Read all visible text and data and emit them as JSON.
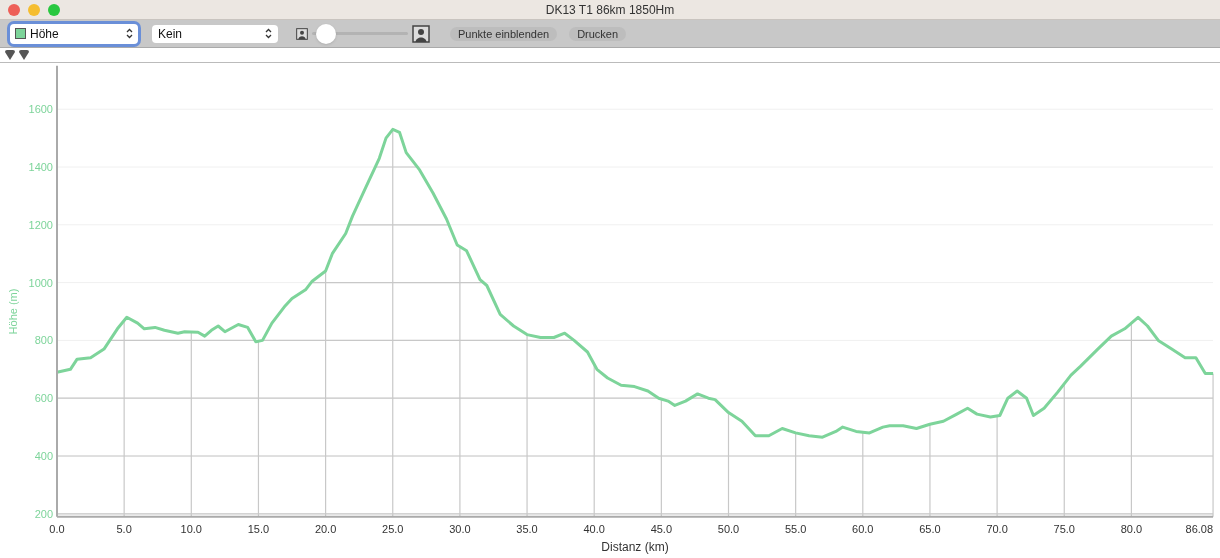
{
  "window": {
    "title": "DK13 T1 86km 1850Hm"
  },
  "toolbar": {
    "secondary_select": {
      "value": "Kein"
    },
    "zoom_slider": {
      "level": 0.05
    },
    "buttons": [
      "Punkte einblenden",
      "Drucken"
    ]
  },
  "chart": {
    "chart_data": {
      "type": "line",
      "grid": true,
      "ref_lines": [
        {
          "axis": "x",
          "value": 5
        },
        {
          "axis": "x",
          "value": 10
        },
        {
          "axis": "x",
          "value": 15
        },
        {
          "axis": "x",
          "value": 20
        },
        {
          "axis": "x",
          "value": 25
        },
        {
          "axis": "x",
          "value": 30
        },
        {
          "axis": "x",
          "value": 35
        },
        {
          "axis": "x",
          "value": 40
        },
        {
          "axis": "x",
          "value": 45
        },
        {
          "axis": "x",
          "value": 50
        },
        {
          "axis": "x",
          "value": 55
        },
        {
          "axis": "x",
          "value": 60
        },
        {
          "axis": "x",
          "value": 65
        },
        {
          "axis": "x",
          "value": 70
        },
        {
          "axis": "x",
          "value": 75
        },
        {
          "axis": "x",
          "value": 80
        },
        {
          "axis": "x",
          "value": 86.08
        }
      ],
      "xlabel": "Distanz (km)",
      "ylabel": "Höhe (m)",
      "xlim": [
        0,
        86.08
      ],
      "ylim": [
        190,
        1750
      ],
      "xticks": [
        {
          "value": 0,
          "label": "0.0"
        },
        {
          "value": 5,
          "label": "5.0"
        },
        {
          "value": 10,
          "label": "10.0"
        },
        {
          "value": 15,
          "label": "15.0"
        },
        {
          "value": 20,
          "label": "20.0"
        },
        {
          "value": 25,
          "label": "25.0"
        },
        {
          "value": 30,
          "label": "30.0"
        },
        {
          "value": 35,
          "label": "35.0"
        },
        {
          "value": 40,
          "label": "40.0"
        },
        {
          "value": 45,
          "label": "45.0"
        },
        {
          "value": 50,
          "label": "50.0"
        },
        {
          "value": 55,
          "label": "55.0"
        },
        {
          "value": 60,
          "label": "60.0"
        },
        {
          "value": 65,
          "label": "65.0"
        },
        {
          "value": 70,
          "label": "70.0"
        },
        {
          "value": 75,
          "label": "75.0"
        },
        {
          "value": 80,
          "label": "80.0"
        },
        {
          "value": 86.08,
          "label": "86.08"
        }
      ],
      "yticks": [
        200,
        400,
        600,
        800,
        1000,
        1200,
        1400,
        1600
      ],
      "x": [
        0,
        1,
        1.5,
        2.5,
        3.5,
        4.5,
        5.2,
        6,
        6.5,
        7.3,
        8,
        9,
        9.5,
        10.5,
        11,
        11.5,
        12,
        12.5,
        13.5,
        14.2,
        14.8,
        15.3,
        16,
        17,
        17.5,
        18.5,
        19,
        20,
        20.5,
        21.5,
        22,
        23,
        24,
        24.5,
        25,
        25.5,
        26,
        27,
        28,
        29,
        29.8,
        30.5,
        31.5,
        32,
        33,
        34,
        35,
        36,
        37,
        37.8,
        38.5,
        39.5,
        40.2,
        41,
        42,
        43,
        44,
        44.8,
        45.5,
        46,
        46.8,
        47.7,
        48.5,
        49,
        50,
        51,
        52,
        53,
        54,
        55,
        56,
        57,
        58,
        58.5,
        59.5,
        60.5,
        61.5,
        62,
        63,
        64,
        65,
        66,
        67,
        67.8,
        68.5,
        69.5,
        70.2,
        70.8,
        71.5,
        72.2,
        72.7,
        73.5,
        74.5,
        75.5,
        76.2,
        77.5,
        78.5,
        79.5,
        80.5,
        81.2,
        82,
        83,
        84,
        84.8,
        85.5,
        86.08
      ],
      "series": [
        {
          "name": "Höhe",
          "color": "#7dd49a",
          "values": [
            690,
            700,
            735,
            740,
            770,
            840,
            880,
            860,
            840,
            845,
            835,
            825,
            830,
            828,
            815,
            835,
            850,
            830,
            855,
            845,
            795,
            800,
            860,
            920,
            945,
            975,
            1005,
            1040,
            1100,
            1170,
            1230,
            1330,
            1430,
            1500,
            1530,
            1520,
            1450,
            1390,
            1310,
            1220,
            1130,
            1110,
            1010,
            990,
            890,
            850,
            820,
            810,
            810,
            825,
            800,
            760,
            700,
            670,
            645,
            640,
            625,
            600,
            590,
            575,
            590,
            615,
            600,
            595,
            550,
            520,
            470,
            470,
            495,
            480,
            470,
            465,
            485,
            500,
            485,
            480,
            500,
            505,
            505,
            495,
            510,
            520,
            545,
            565,
            545,
            535,
            540,
            600,
            625,
            600,
            540,
            565,
            620,
            680,
            710,
            770,
            815,
            840,
            880,
            850,
            800,
            770,
            740,
            740,
            685,
            685
          ]
        }
      ]
    }
  }
}
